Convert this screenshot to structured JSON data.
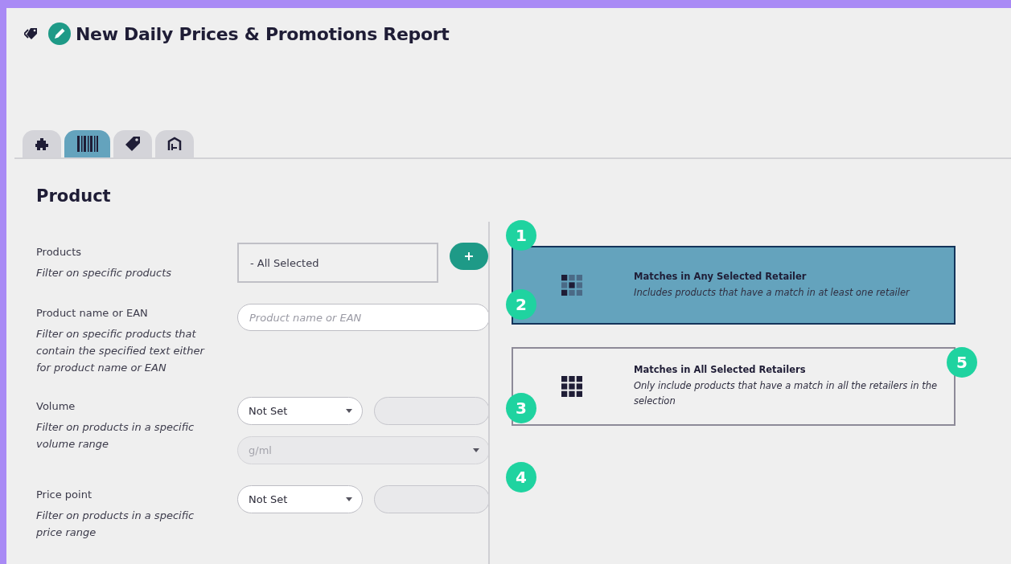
{
  "report": {
    "title": "New Daily Prices & Promotions Report"
  },
  "tabs": [
    {
      "kind": "puzzle",
      "selected": false
    },
    {
      "kind": "barcode",
      "selected": true
    },
    {
      "kind": "tag",
      "selected": false
    },
    {
      "kind": "store",
      "selected": false
    }
  ],
  "section": {
    "title": "Product"
  },
  "filters": [
    {
      "label": "Products",
      "description": "Filter on specific products",
      "kind": "multiselect",
      "value": "- All Selected"
    },
    {
      "label": "Product name or EAN",
      "description": "Filter on specific products that contain the specified text either for product name or EAN",
      "kind": "text",
      "placeholder": "Product name or EAN"
    },
    {
      "label": "Volume",
      "description": "Filter on products in a specific volume range",
      "kind": "range",
      "operator": "Not Set",
      "unit": "g/ml"
    },
    {
      "label": "Price point",
      "description": "Filter on products in a specific price range",
      "kind": "range",
      "operator": "Not Set"
    }
  ],
  "match_options": [
    {
      "title": "Matches in Any Selected Retailer",
      "description": "Includes products that have a match in at least one retailer",
      "kind": "any",
      "selected": true
    },
    {
      "title": "Matches in All Selected Retailers",
      "description": "Only include products that have a match in all the retailers in the selection",
      "kind": "all",
      "selected": false
    }
  ],
  "callouts": [
    "1",
    "2",
    "3",
    "4",
    "5"
  ]
}
